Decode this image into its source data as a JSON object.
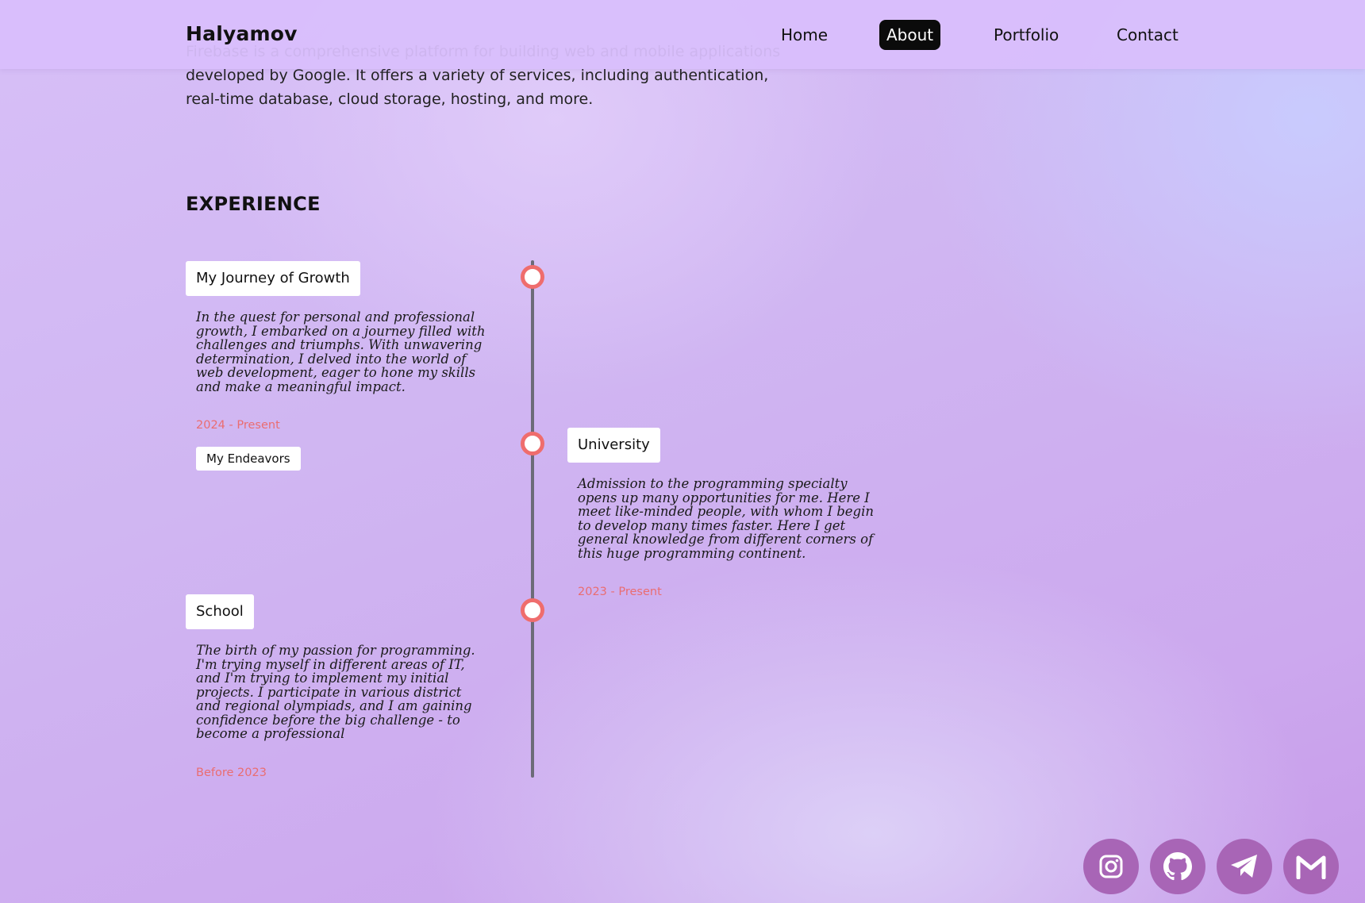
{
  "header": {
    "logo": "Halyamov",
    "nav": [
      {
        "label": "Home",
        "active": false
      },
      {
        "label": "About",
        "active": true
      },
      {
        "label": "Portfolio",
        "active": false
      },
      {
        "label": "Contact",
        "active": false
      }
    ]
  },
  "intro": {
    "text": "Firebase is a comprehensive platform for building web and mobile applications developed by Google. It offers a variety of services, including authentication, real-time database, cloud storage, hosting, and more."
  },
  "experience": {
    "title": "EXPERIENCE",
    "entries": [
      {
        "title": "My Journey of Growth",
        "description": "In the quest for personal and professional growth, I embarked on a journey filled with challenges and triumphs. With unwavering determination, I delved into the world of web development, eager to hone my skills and make a meaningful impact.",
        "date": "2024 - Present",
        "button": "My Endeavors"
      },
      {
        "title": "University",
        "description": "Admission to the programming specialty opens up many opportunities for me. Here I meet like-minded people, with whom I begin to develop many times faster. Here I get general knowledge from different corners of this huge programming continent.",
        "date": "2023 - Present"
      },
      {
        "title": "School",
        "description": "The birth of my passion for programming. I'm trying myself in different areas of IT, and I'm trying to implement my initial projects. I participate in various district and regional olympiads, and I am gaining confidence before the big challenge - to become a professional",
        "date": "Before 2023"
      }
    ]
  },
  "social": [
    {
      "icon": "instagram-icon"
    },
    {
      "icon": "github-icon"
    },
    {
      "icon": "telegram-icon"
    },
    {
      "icon": "gmail-icon"
    }
  ],
  "colors": {
    "accent": "#ef6d6d",
    "social_bg": "#a865b6",
    "nav_active_bg": "#0b0b0b",
    "header_bg": "#d9befc"
  }
}
